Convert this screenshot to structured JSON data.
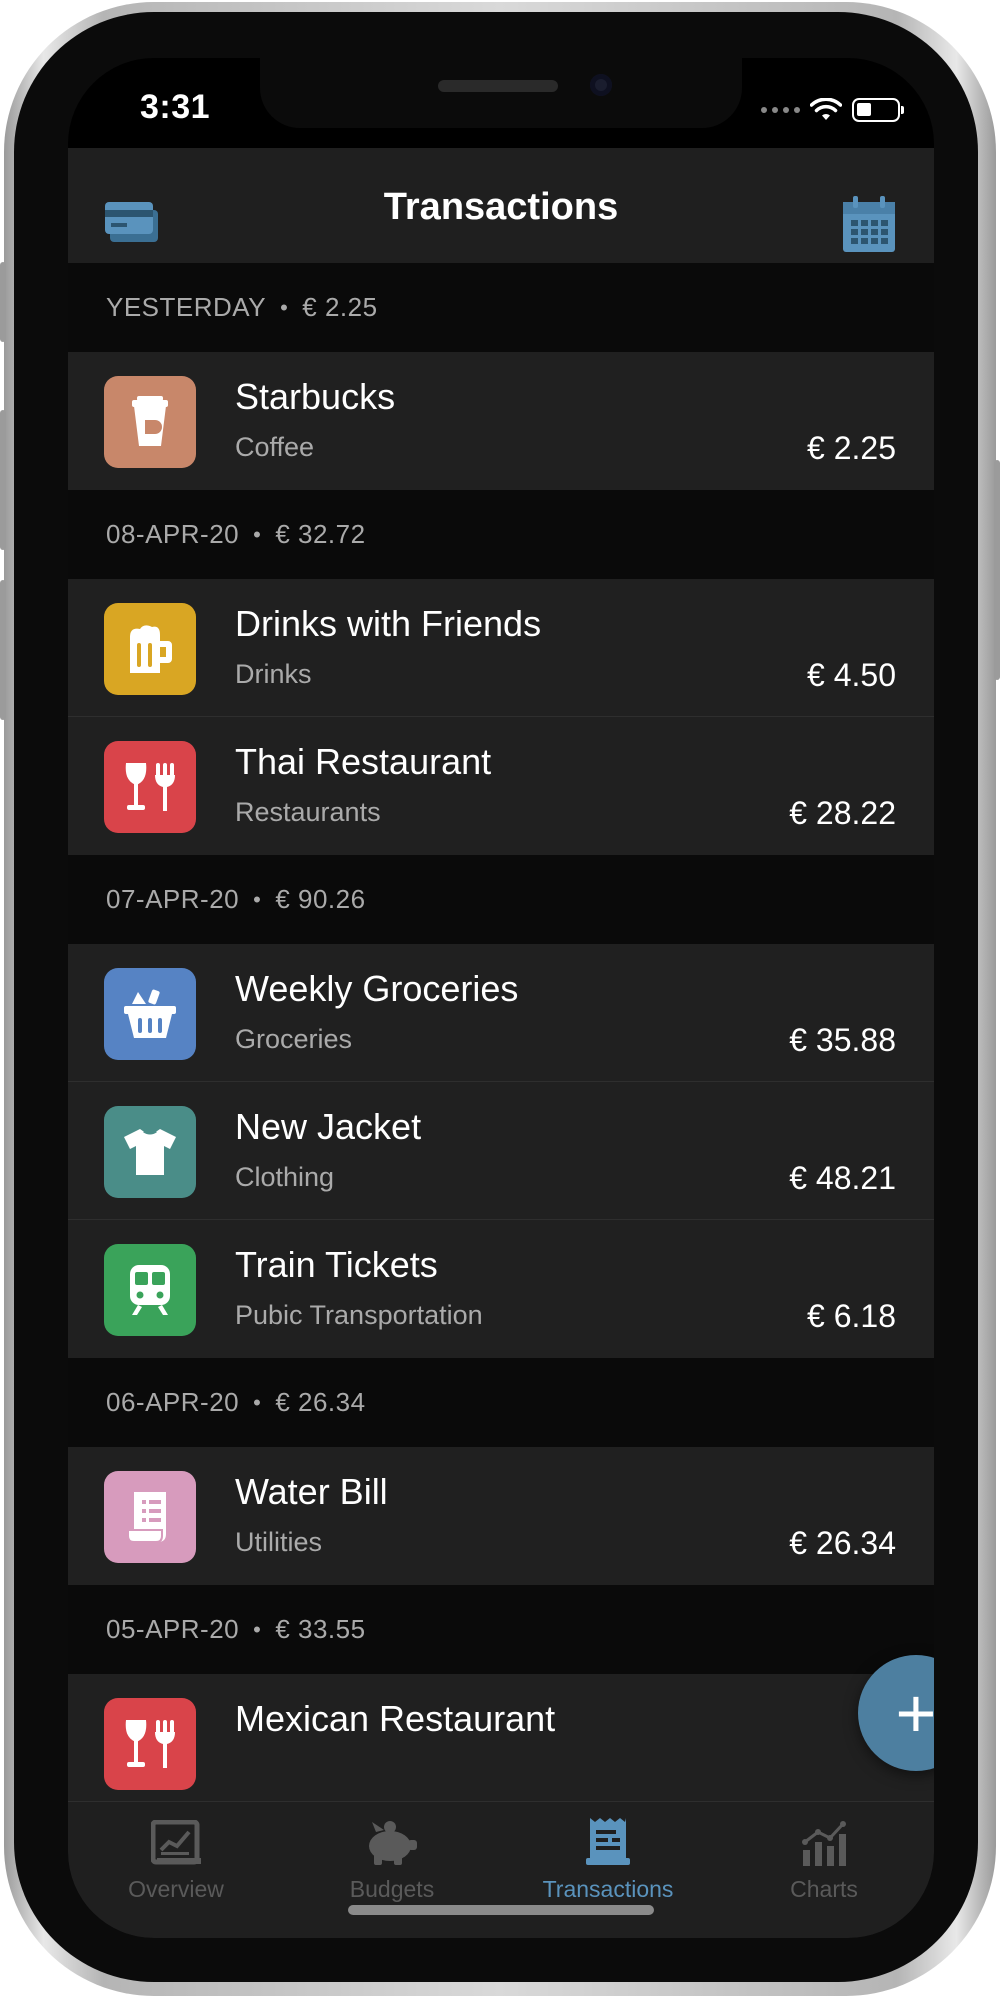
{
  "status_bar": {
    "time": "3:31"
  },
  "header": {
    "title": "Transactions",
    "left_icon": "cards-icon",
    "right_icon": "calendar-icon"
  },
  "sections": [
    {
      "date": "YESTERDAY",
      "total": "€ 2.25",
      "items": [
        {
          "title": "Starbucks",
          "category": "Coffee",
          "amount": "€ 2.25",
          "icon": "coffee-cup-icon",
          "color": "#c8876a"
        }
      ]
    },
    {
      "date": "08-APR-20",
      "total": "€ 32.72",
      "items": [
        {
          "title": "Drinks with Friends",
          "category": "Drinks",
          "amount": "€ 4.50",
          "icon": "beer-mug-icon",
          "color": "#d9a623"
        },
        {
          "title": "Thai Restaurant",
          "category": "Restaurants",
          "amount": "€ 28.22",
          "icon": "wine-fork-icon",
          "color": "#d9444a"
        }
      ]
    },
    {
      "date": "07-APR-20",
      "total": "€ 90.26",
      "items": [
        {
          "title": "Weekly Groceries",
          "category": "Groceries",
          "amount": "€ 35.88",
          "icon": "grocery-basket-icon",
          "color": "#5683c4"
        },
        {
          "title": "New Jacket",
          "category": "Clothing",
          "amount": "€ 48.21",
          "icon": "tshirt-icon",
          "color": "#4a8d88"
        },
        {
          "title": "Train Tickets",
          "category": "Pubic Transportation",
          "amount": "€ 6.18",
          "icon": "train-icon",
          "color": "#3aa35a"
        }
      ]
    },
    {
      "date": "06-APR-20",
      "total": "€ 26.34",
      "items": [
        {
          "title": "Water Bill",
          "category": "Utilities",
          "amount": "€ 26.34",
          "icon": "bill-receipt-icon",
          "color": "#d79bbd"
        }
      ]
    },
    {
      "date": "05-APR-20",
      "total": "€ 33.55",
      "items": [
        {
          "title": "Mexican Restaurant",
          "category": "",
          "amount": "",
          "icon": "wine-fork-icon",
          "color": "#d9444a"
        }
      ]
    }
  ],
  "fab": {
    "label": "+"
  },
  "tabs": [
    {
      "label": "Overview",
      "icon": "overview-chart-icon",
      "active": false
    },
    {
      "label": "Budgets",
      "icon": "piggy-bank-icon",
      "active": false
    },
    {
      "label": "Transactions",
      "icon": "receipt-icon",
      "active": true
    },
    {
      "label": "Charts",
      "icon": "bar-chart-icon",
      "active": false
    }
  ],
  "colors": {
    "accent": "#4d7fa0",
    "tab_active": "#5a93bd",
    "tab_inactive": "#5a5a5a"
  }
}
